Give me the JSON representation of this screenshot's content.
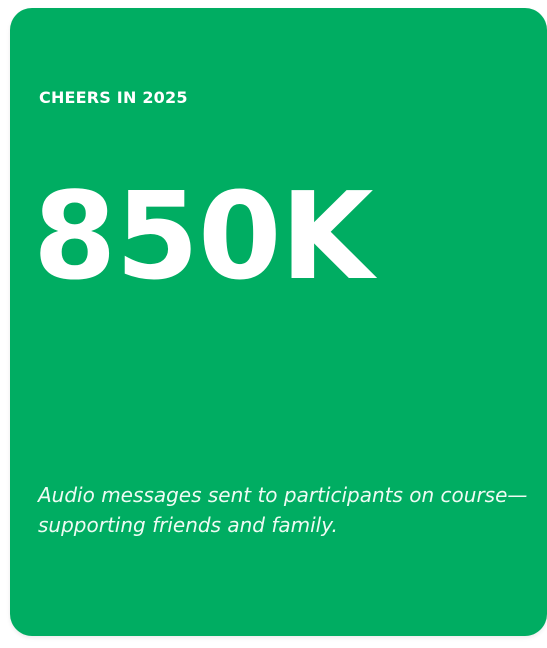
{
  "card": {
    "kicker": "CHEERS IN 2025",
    "value": "850K",
    "description": "Audio messages sent to participants on course—supporting friends and family.",
    "background_color": "#00ad62",
    "text_color": "#ffffff"
  }
}
